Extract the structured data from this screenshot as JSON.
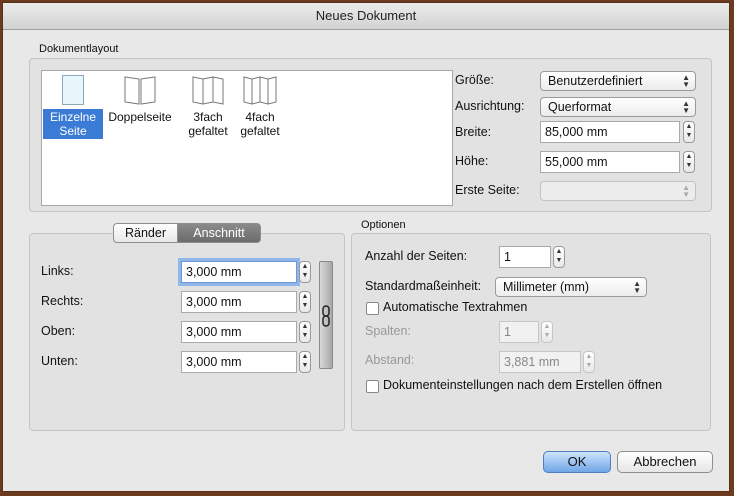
{
  "window": {
    "title": "Neues Dokument"
  },
  "layout_group": {
    "label": "Dokumentlayout",
    "items": [
      {
        "label_line1": "Einzelne",
        "label_line2": "Seite",
        "selected": true
      },
      {
        "label_line1": "Doppelseite",
        "label_line2": ""
      },
      {
        "label_line1": "3fach",
        "label_line2": "gefaltet"
      },
      {
        "label_line1": "4fach",
        "label_line2": "gefaltet"
      }
    ],
    "size_label": "Größe:",
    "size_value": "Benutzerdefiniert",
    "orientation_label": "Ausrichtung:",
    "orientation_value": "Querformat",
    "width_label": "Breite:",
    "width_value": "85,000 mm",
    "height_label": "Höhe:",
    "height_value": "55,000 mm",
    "first_page_label": "Erste Seite:",
    "first_page_value": ""
  },
  "margins": {
    "tabs": [
      {
        "label": "Ränder"
      },
      {
        "label": "Anschnitt",
        "active": true
      }
    ],
    "left_label": "Links:",
    "left_value": "3,000 mm",
    "right_label": "Rechts:",
    "right_value": "3,000 mm",
    "top_label": "Oben:",
    "top_value": "3,000 mm",
    "bottom_label": "Unten:",
    "bottom_value": "3,000 mm"
  },
  "options": {
    "label": "Optionen",
    "pages_label": "Anzahl der Seiten:",
    "pages_value": "1",
    "unit_label": "Standardmaßeinheit:",
    "unit_value": "Millimeter (mm)",
    "auto_text_label": "Automatische Textrahmen",
    "columns_label": "Spalten:",
    "columns_value": "1",
    "gap_label": "Abstand:",
    "gap_value": "3,881 mm",
    "open_settings_label": "Dokumenteinstellungen nach dem Erstellen öffnen"
  },
  "buttons": {
    "ok": "OK",
    "cancel": "Abbrechen"
  },
  "colors": {
    "accent": "#3a7bd5",
    "border": "#6b3a1f"
  }
}
